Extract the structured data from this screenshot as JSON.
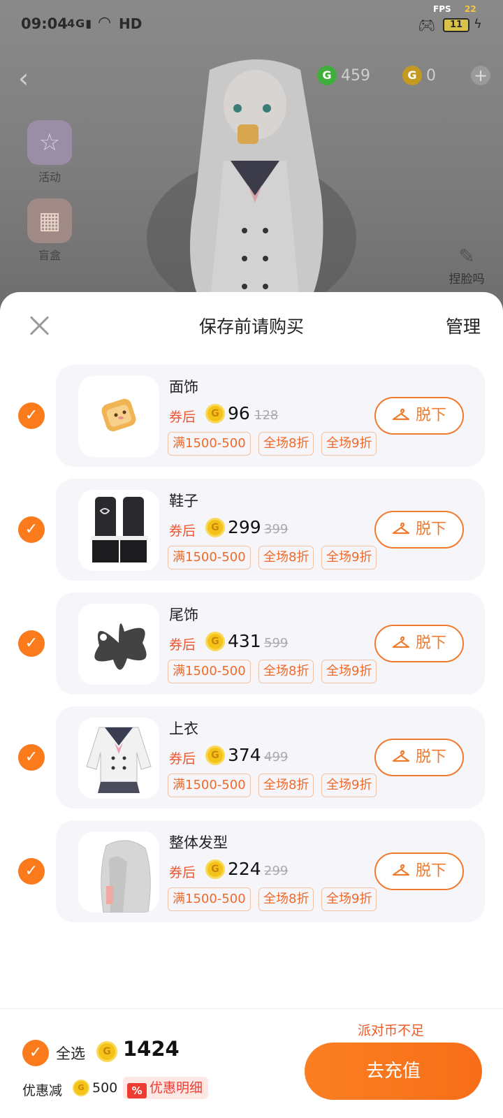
{
  "status_bar": {
    "time": "09:04",
    "network": "4G",
    "hd": "HD",
    "fps_label": "FPS",
    "fps_value": "22",
    "battery": "11"
  },
  "scene": {
    "back_icon": "back-arrow-icon",
    "green_coin_symbol": "G",
    "green_coin_value": "459",
    "gold_coin_symbol": "G",
    "gold_coin_value": "0",
    "side_items": [
      {
        "label": "活动",
        "icon": "star-icon"
      },
      {
        "label": "盲盒",
        "icon": "gift-box-icon"
      }
    ],
    "edit_label": "捏脸吗"
  },
  "sheet": {
    "title": "保存前请购买",
    "manage": "管理",
    "coupon_label": "券后",
    "take_off_label": "脱下",
    "tags": [
      "满1500-500",
      "全场8折",
      "全场9折"
    ],
    "items": [
      {
        "name": "面饰",
        "price": "96",
        "original": "128"
      },
      {
        "name": "鞋子",
        "price": "299",
        "original": "399"
      },
      {
        "name": "尾饰",
        "price": "431",
        "original": "599"
      },
      {
        "name": "上衣",
        "price": "374",
        "original": "499"
      },
      {
        "name": "整体发型",
        "price": "224",
        "original": "299"
      }
    ]
  },
  "footer": {
    "select_all": "全选",
    "total": "1424",
    "discount_label": "优惠减",
    "discount_value": "500",
    "detail_icon": "%",
    "detail_link": "优惠明细",
    "insufficient": "派对币不足",
    "recharge": "去充值"
  },
  "colors": {
    "accent": "#fa7a1c",
    "tag_text": "#ef6a28",
    "coupon_red": "#f0542d",
    "coin_gold": "#f5c318"
  }
}
